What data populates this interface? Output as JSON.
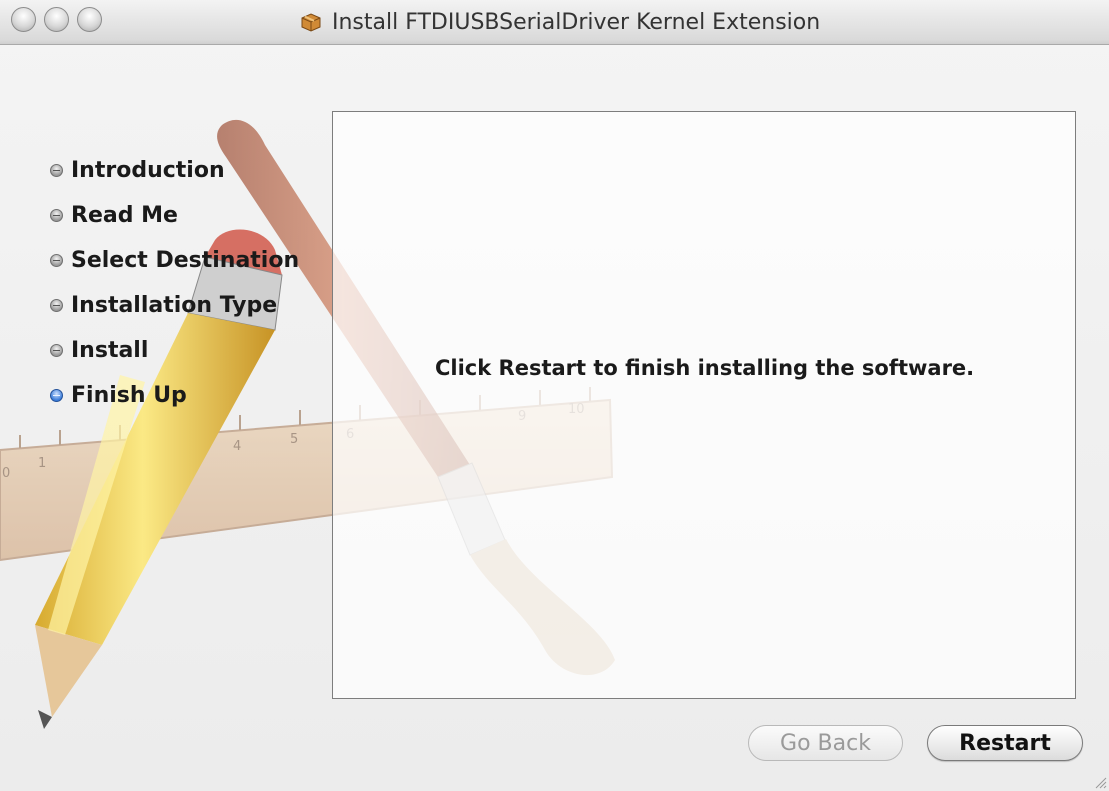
{
  "window": {
    "title": "Install FTDIUSBSerialDriver Kernel Extension",
    "title_icon": "package-icon"
  },
  "steps": [
    {
      "label": "Introduction",
      "active": false
    },
    {
      "label": "Read Me",
      "active": false
    },
    {
      "label": "Select Destination",
      "active": false
    },
    {
      "label": "Installation Type",
      "active": false
    },
    {
      "label": "Install",
      "active": false
    },
    {
      "label": "Finish Up",
      "active": true
    }
  ],
  "content": {
    "message": "Click Restart to finish installing the software."
  },
  "buttons": {
    "go_back": "Go Back",
    "restart": "Restart"
  },
  "ruler_ticks": [
    "0",
    "1",
    "4",
    "5",
    "6",
    "9",
    "10"
  ],
  "colors": {
    "active_step": "#3a7bd8",
    "panel_border": "#7d7d7d"
  }
}
